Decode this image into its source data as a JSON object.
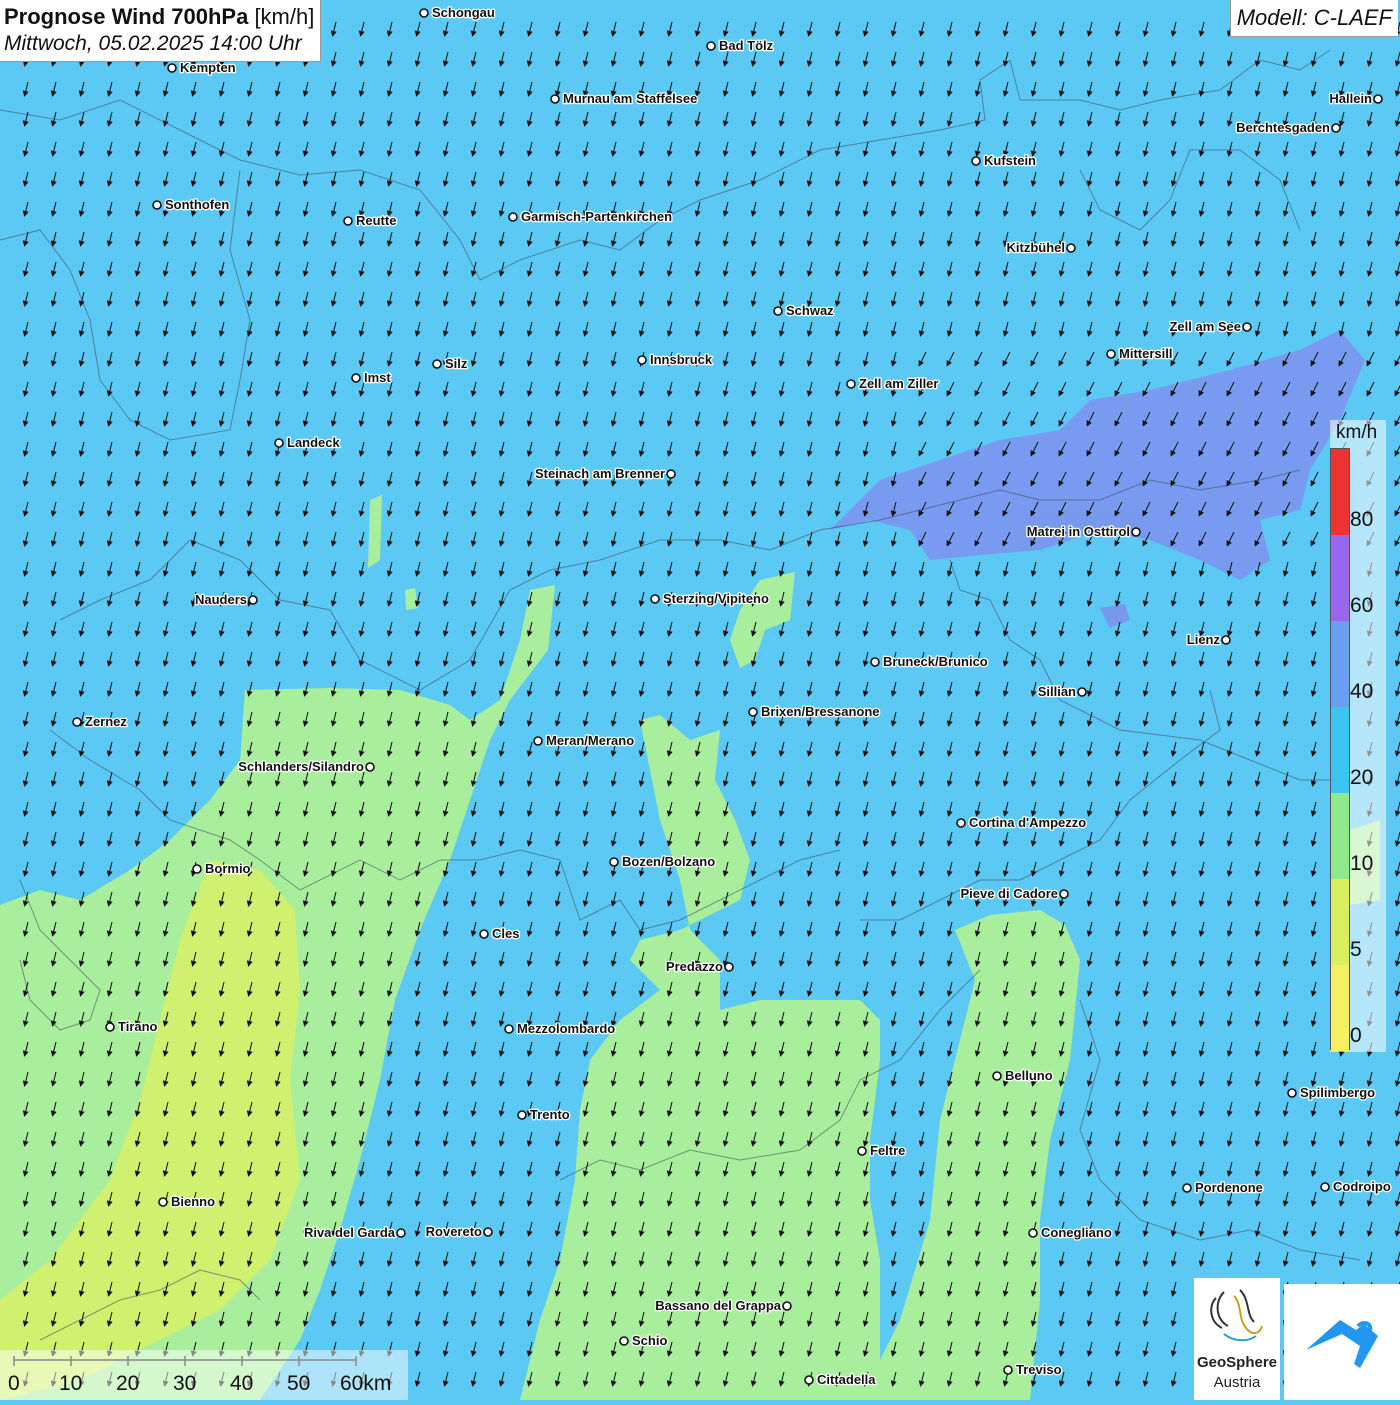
{
  "header": {
    "title_bold": "Prognose Wind 700hPa",
    "title_unit": "[km/h]",
    "datetime": "Mittwoch, 05.02.2025 14:00 Uhr",
    "model": "Modell: C-LAEF"
  },
  "legend": {
    "unit": "km/h",
    "labels": [
      "80",
      "60",
      "40",
      "20",
      "10",
      "5",
      "0"
    ],
    "colors": [
      "#ee3333",
      "#9966ee",
      "#6a9ef0",
      "#3cc4f0",
      "#8fe88a",
      "#d7f060",
      "#f4f060"
    ]
  },
  "scale_bar": {
    "labels": [
      "0",
      "10",
      "20",
      "30",
      "40",
      "50",
      "60km"
    ]
  },
  "logos": {
    "geosphere_line1": "GeoSphere",
    "geosphere_line2": "Austria"
  },
  "colors": {
    "wind_blue": "#5cc8f4",
    "wind_green": "#a8ee9c",
    "wind_yellow": "#d4f06a",
    "wind_violet": "#7c92ee",
    "arrow": "#111111"
  },
  "cities": [
    {
      "name": "Schongau"
    },
    {
      "name": "Bad Tölz"
    },
    {
      "name": "Kempten"
    },
    {
      "name": "Murnau am Staffelsee"
    },
    {
      "name": "Hallein"
    },
    {
      "name": "Berchtesgaden"
    },
    {
      "name": "Kufstein"
    },
    {
      "name": "Sonthofen"
    },
    {
      "name": "Reutte"
    },
    {
      "name": "Garmisch-Partenkirchen"
    },
    {
      "name": "Kitzbühel"
    },
    {
      "name": "Schwaz"
    },
    {
      "name": "Zell am See"
    },
    {
      "name": "Mittersill"
    },
    {
      "name": "Innsbruck"
    },
    {
      "name": "Silz"
    },
    {
      "name": "Imst"
    },
    {
      "name": "Zell am Ziller"
    },
    {
      "name": "Landeck"
    },
    {
      "name": "Steinach am Brenner"
    },
    {
      "name": "Matrei in Osttirol"
    },
    {
      "name": "Nauders"
    },
    {
      "name": "Sterzing/Vipiteno"
    },
    {
      "name": "Lienz"
    },
    {
      "name": "Bruneck/Brunico"
    },
    {
      "name": "Sillian"
    },
    {
      "name": "Zernez"
    },
    {
      "name": "Brixen/Bressanone"
    },
    {
      "name": "Meran/Merano"
    },
    {
      "name": "Schlanders/Silandro"
    },
    {
      "name": "Cortina d'Ampezzo"
    },
    {
      "name": "Bormio"
    },
    {
      "name": "Bozen/Bolzano"
    },
    {
      "name": "Pieve di Cadore"
    },
    {
      "name": "Cles"
    },
    {
      "name": "Predazzo"
    },
    {
      "name": "Tirano"
    },
    {
      "name": "Mezzolombardo"
    },
    {
      "name": "Belluno"
    },
    {
      "name": "Spilimbergo"
    },
    {
      "name": "Trento"
    },
    {
      "name": "Feltre"
    },
    {
      "name": "Pordenone"
    },
    {
      "name": "Codroipo"
    },
    {
      "name": "Bienno"
    },
    {
      "name": "Riva del Garda"
    },
    {
      "name": "Rovereto"
    },
    {
      "name": "Conegliano"
    },
    {
      "name": "Bassano del Grappa"
    },
    {
      "name": "Schio"
    },
    {
      "name": "Cittadella"
    },
    {
      "name": "Treviso"
    }
  ]
}
